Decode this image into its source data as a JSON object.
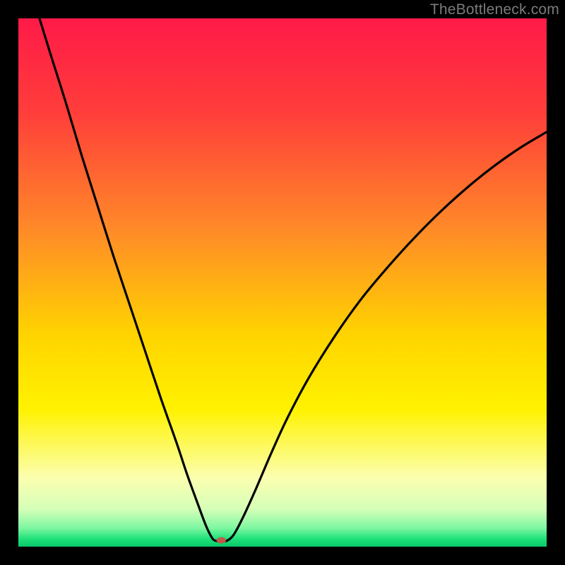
{
  "watermark": "TheBottleneck.com",
  "chart_data": {
    "type": "line",
    "title": "",
    "xlabel": "",
    "ylabel": "",
    "xlim": [
      0,
      100
    ],
    "ylim": [
      0,
      100
    ],
    "gradient_stops": [
      {
        "offset": 0,
        "color": "#ff1a48"
      },
      {
        "offset": 0.18,
        "color": "#ff3e3a"
      },
      {
        "offset": 0.4,
        "color": "#ff8a28"
      },
      {
        "offset": 0.6,
        "color": "#ffd400"
      },
      {
        "offset": 0.74,
        "color": "#fff200"
      },
      {
        "offset": 0.87,
        "color": "#fbffb0"
      },
      {
        "offset": 0.93,
        "color": "#d4ffb8"
      },
      {
        "offset": 0.965,
        "color": "#7cf7a0"
      },
      {
        "offset": 0.985,
        "color": "#1fe27a"
      },
      {
        "offset": 1.0,
        "color": "#08c96a"
      }
    ],
    "curve_points": [
      {
        "x": 4.0,
        "y": 100.0
      },
      {
        "x": 6.0,
        "y": 93.5
      },
      {
        "x": 9.0,
        "y": 84.0
      },
      {
        "x": 12.0,
        "y": 74.0
      },
      {
        "x": 15.0,
        "y": 64.5
      },
      {
        "x": 18.0,
        "y": 55.0
      },
      {
        "x": 21.0,
        "y": 46.0
      },
      {
        "x": 24.0,
        "y": 37.0
      },
      {
        "x": 27.0,
        "y": 28.0
      },
      {
        "x": 30.0,
        "y": 19.5
      },
      {
        "x": 32.0,
        "y": 13.5
      },
      {
        "x": 34.0,
        "y": 8.0
      },
      {
        "x": 35.5,
        "y": 4.0
      },
      {
        "x": 36.7,
        "y": 1.6
      },
      {
        "x": 37.4,
        "y": 1.1
      },
      {
        "x": 38.2,
        "y": 1.0
      },
      {
        "x": 39.0,
        "y": 1.0
      },
      {
        "x": 39.8,
        "y": 1.3
      },
      {
        "x": 40.8,
        "y": 2.3
      },
      {
        "x": 42.5,
        "y": 5.5
      },
      {
        "x": 45.0,
        "y": 11.0
      },
      {
        "x": 48.0,
        "y": 18.0
      },
      {
        "x": 51.0,
        "y": 24.5
      },
      {
        "x": 55.0,
        "y": 32.0
      },
      {
        "x": 60.0,
        "y": 40.0
      },
      {
        "x": 65.0,
        "y": 47.0
      },
      {
        "x": 70.0,
        "y": 53.0
      },
      {
        "x": 75.0,
        "y": 58.5
      },
      {
        "x": 80.0,
        "y": 63.5
      },
      {
        "x": 85.0,
        "y": 68.0
      },
      {
        "x": 90.0,
        "y": 72.0
      },
      {
        "x": 95.0,
        "y": 75.5
      },
      {
        "x": 100.0,
        "y": 78.5
      }
    ],
    "marker": {
      "x": 38.4,
      "y": 1.2,
      "rx": 0.9,
      "ry": 0.6,
      "color": "#c05a4a"
    }
  }
}
